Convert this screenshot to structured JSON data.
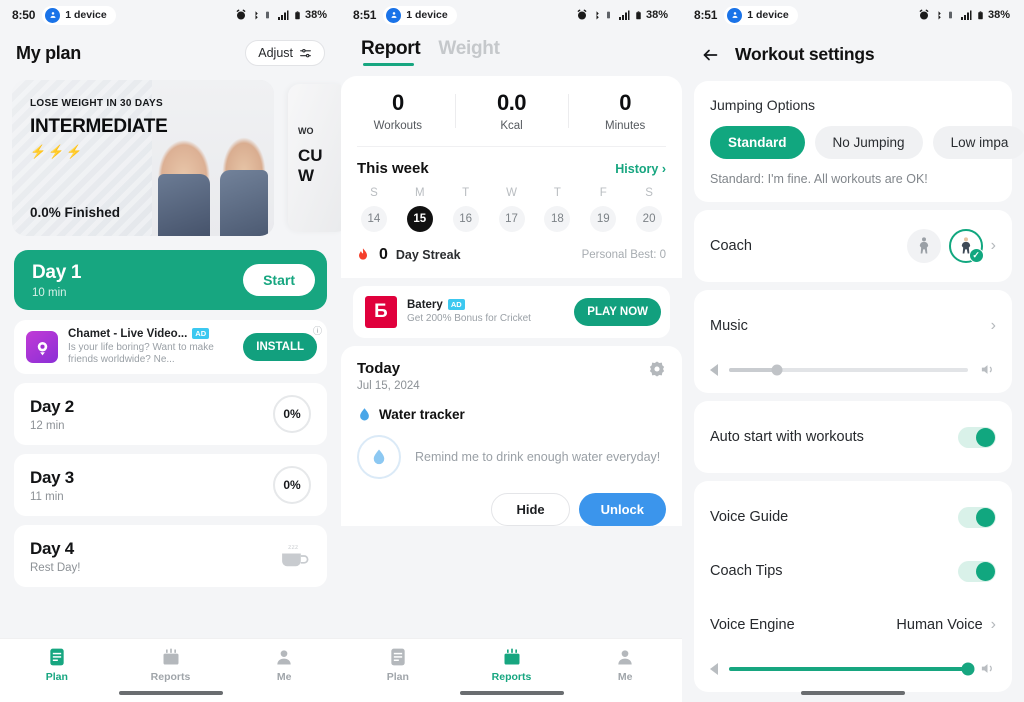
{
  "accent": {
    "green": "#17a680",
    "green_dark": "#11a77f",
    "blue": "#3b95ec",
    "black": "#111111"
  },
  "statusbar": {
    "time_1": "8:50",
    "time_2": "8:51",
    "time_3": "8:51",
    "device_label": "1 device",
    "battery": "38%",
    "icons": [
      "alarm-icon",
      "bluetooth-icon",
      "vibrate-icon",
      "signal-4g-icon",
      "battery-icon"
    ]
  },
  "plan_screen": {
    "title": "My plan",
    "adjust_label": "Adjust",
    "hero_card": {
      "kicker": "LOSE WEIGHT IN 30 DAYS",
      "level": "INTERMEDIATE",
      "bolts_on": 2,
      "bolts_total": 3,
      "progress": "0.0% Finished"
    },
    "peek_card": {
      "line1": "WO",
      "line2": "CU",
      "line3": "W"
    },
    "today": {
      "name": "Day 1",
      "minutes": "10 min",
      "start_label": "Start"
    },
    "ad": {
      "title": "Chamet - Live Video...",
      "badge": "AD",
      "desc": "Is your life boring? Want to make friends worldwide? Ne...",
      "cta": "INSTALL"
    },
    "days": [
      {
        "name": "Day 2",
        "sub": "12 min",
        "progress": "0%",
        "rest": false
      },
      {
        "name": "Day 3",
        "sub": "11 min",
        "progress": "0%",
        "rest": false
      },
      {
        "name": "Day 4",
        "sub": "Rest Day!",
        "progress": "",
        "rest": true
      }
    ],
    "tabs": [
      {
        "label": "Plan",
        "icon": "plan-icon",
        "active": true
      },
      {
        "label": "Reports",
        "icon": "reports-icon",
        "active": false
      },
      {
        "label": "Me",
        "icon": "profile-icon",
        "active": false
      }
    ]
  },
  "report_screen": {
    "tabs": [
      {
        "label": "Report",
        "active": true
      },
      {
        "label": "Weight",
        "active": false
      }
    ],
    "stats": [
      {
        "value": "0",
        "label": "Workouts"
      },
      {
        "value": "0.0",
        "label": "Kcal"
      },
      {
        "value": "0",
        "label": "Minutes"
      }
    ],
    "week": {
      "title": "This week",
      "history_label": "History",
      "days": [
        {
          "dow": "S",
          "num": "14",
          "today": false
        },
        {
          "dow": "M",
          "num": "15",
          "today": true
        },
        {
          "dow": "T",
          "num": "16",
          "today": false
        },
        {
          "dow": "W",
          "num": "17",
          "today": false
        },
        {
          "dow": "T",
          "num": "18",
          "today": false
        },
        {
          "dow": "F",
          "num": "19",
          "today": false
        },
        {
          "dow": "S",
          "num": "20",
          "today": false
        }
      ],
      "streak_count": "0",
      "streak_label": "Day Streak",
      "personal_best": "Personal Best: 0"
    },
    "ad": {
      "title": "Batery",
      "badge": "AD",
      "desc": "Get 200% Bonus for Cricket",
      "cta": "PLAY NOW"
    },
    "today": {
      "title": "Today",
      "date": "Jul 15, 2024",
      "water_title": "Water tracker",
      "water_msg": "Remind me to drink enough water everyday!",
      "hide_label": "Hide",
      "unlock_label": "Unlock"
    },
    "tabs_bottom": [
      {
        "label": "Plan",
        "icon": "plan-icon",
        "active": false
      },
      {
        "label": "Reports",
        "icon": "reports-icon",
        "active": true
      },
      {
        "label": "Me",
        "icon": "profile-icon",
        "active": false
      }
    ]
  },
  "settings_screen": {
    "title": "Workout settings",
    "jumping": {
      "label": "Jumping Options",
      "options": [
        {
          "label": "Standard",
          "selected": true
        },
        {
          "label": "No Jumping",
          "selected": false
        },
        {
          "label": "Low impa",
          "selected": false
        }
      ],
      "description": "Standard: I'm fine. All workouts are OK!"
    },
    "coach": {
      "label": "Coach",
      "selected_index": 1
    },
    "music": {
      "label": "Music",
      "volume_percent": 20
    },
    "auto_start": {
      "label": "Auto start with workouts",
      "on": true
    },
    "voice_guide": {
      "label": "Voice Guide",
      "on": true
    },
    "coach_tips": {
      "label": "Coach Tips",
      "on": true
    },
    "voice_engine": {
      "label": "Voice Engine",
      "value": "Human Voice"
    },
    "voice_volume_percent": 100
  }
}
